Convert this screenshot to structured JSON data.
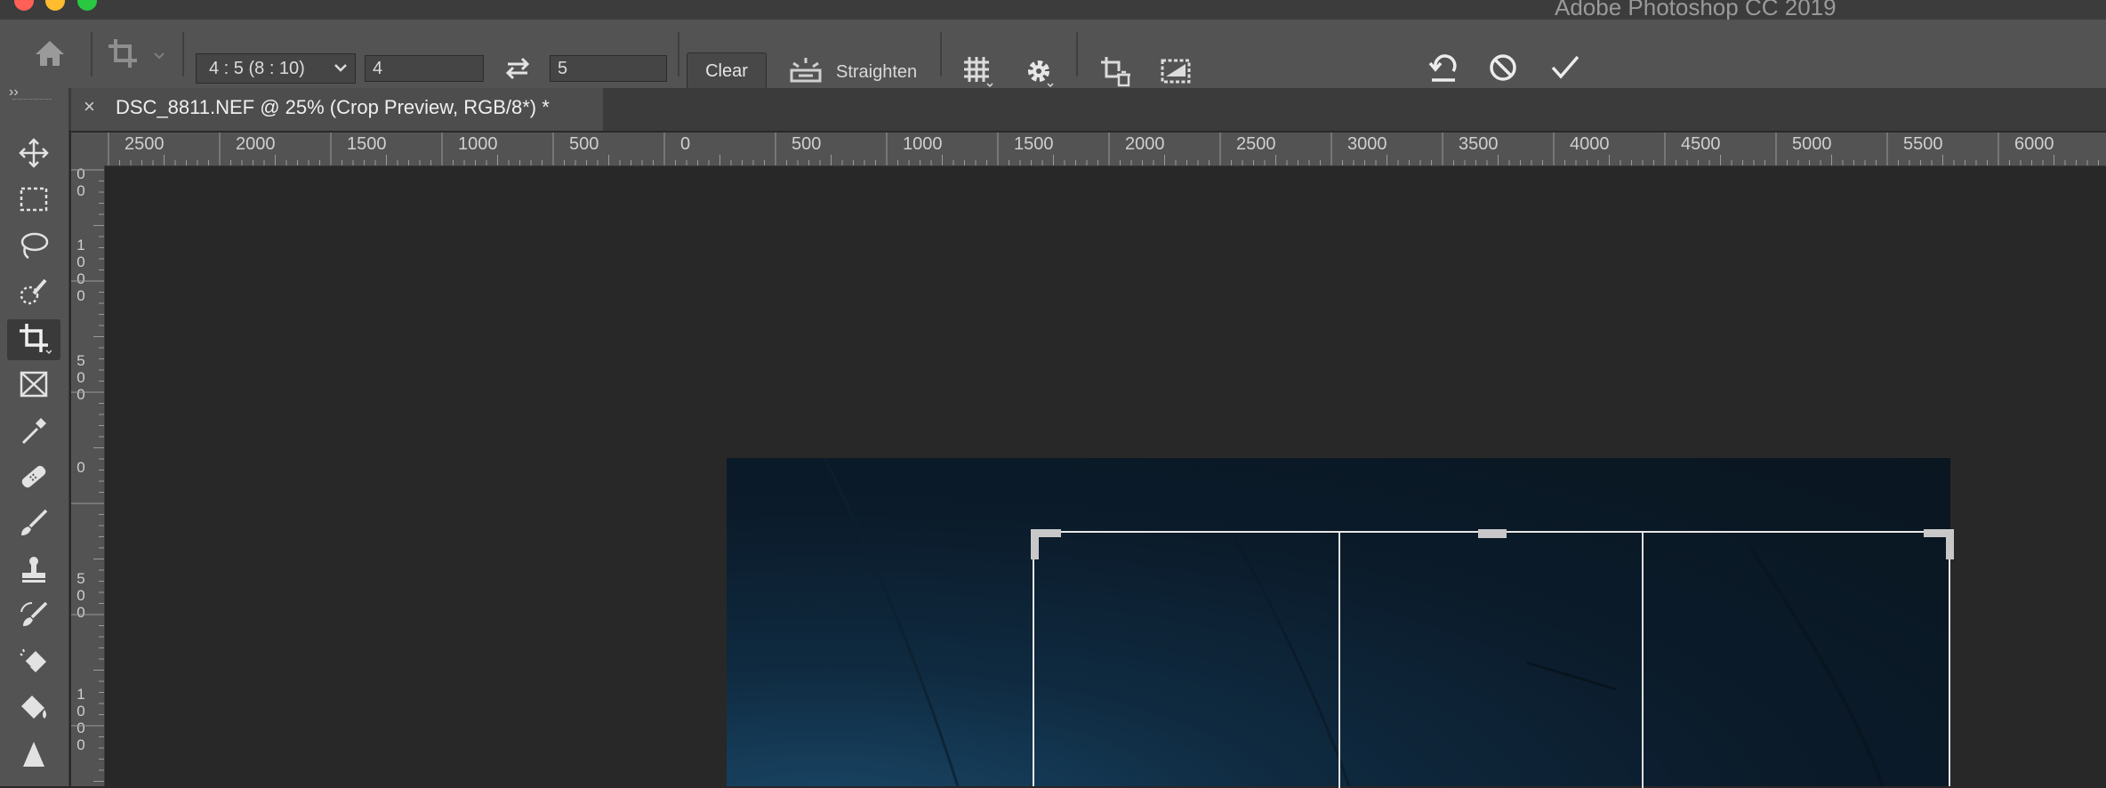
{
  "app": {
    "title": "Adobe Photoshop CC 2019"
  },
  "options_bar": {
    "ratio_preset": "4 : 5 (8 : 10)",
    "width_value": "4",
    "height_value": "5",
    "clear_label": "Clear",
    "straighten_label": "Straighten"
  },
  "document": {
    "tab_title": "DSC_8811.NEF @ 25% (Crop Preview, RGB/8*) *",
    "close_glyph": "×"
  },
  "ruler": {
    "horizontal": [
      "2500",
      "2000",
      "1500",
      "1000",
      "500",
      "0",
      "500",
      "1000",
      "1500",
      "2000",
      "2500",
      "3000",
      "3500",
      "4000",
      "4500",
      "5000",
      "5500",
      "6000"
    ],
    "vertical": [
      "0 0",
      "1 0 0 0",
      "5 0 0",
      "0",
      "5 0 0",
      "1 0 0 0"
    ]
  },
  "tools": [
    "move-icon",
    "marquee-icon",
    "lasso-icon",
    "quick-select-icon",
    "crop-icon",
    "frame-icon",
    "eyedropper-icon",
    "healing-brush-icon",
    "brush-icon",
    "clone-stamp-icon",
    "history-brush-icon",
    "eraser-icon",
    "paint-bucket-icon",
    "blur-icon"
  ],
  "colors": {
    "accent_red": "#fe5f57",
    "accent_yellow": "#febc2e",
    "accent_green": "#28c840"
  }
}
